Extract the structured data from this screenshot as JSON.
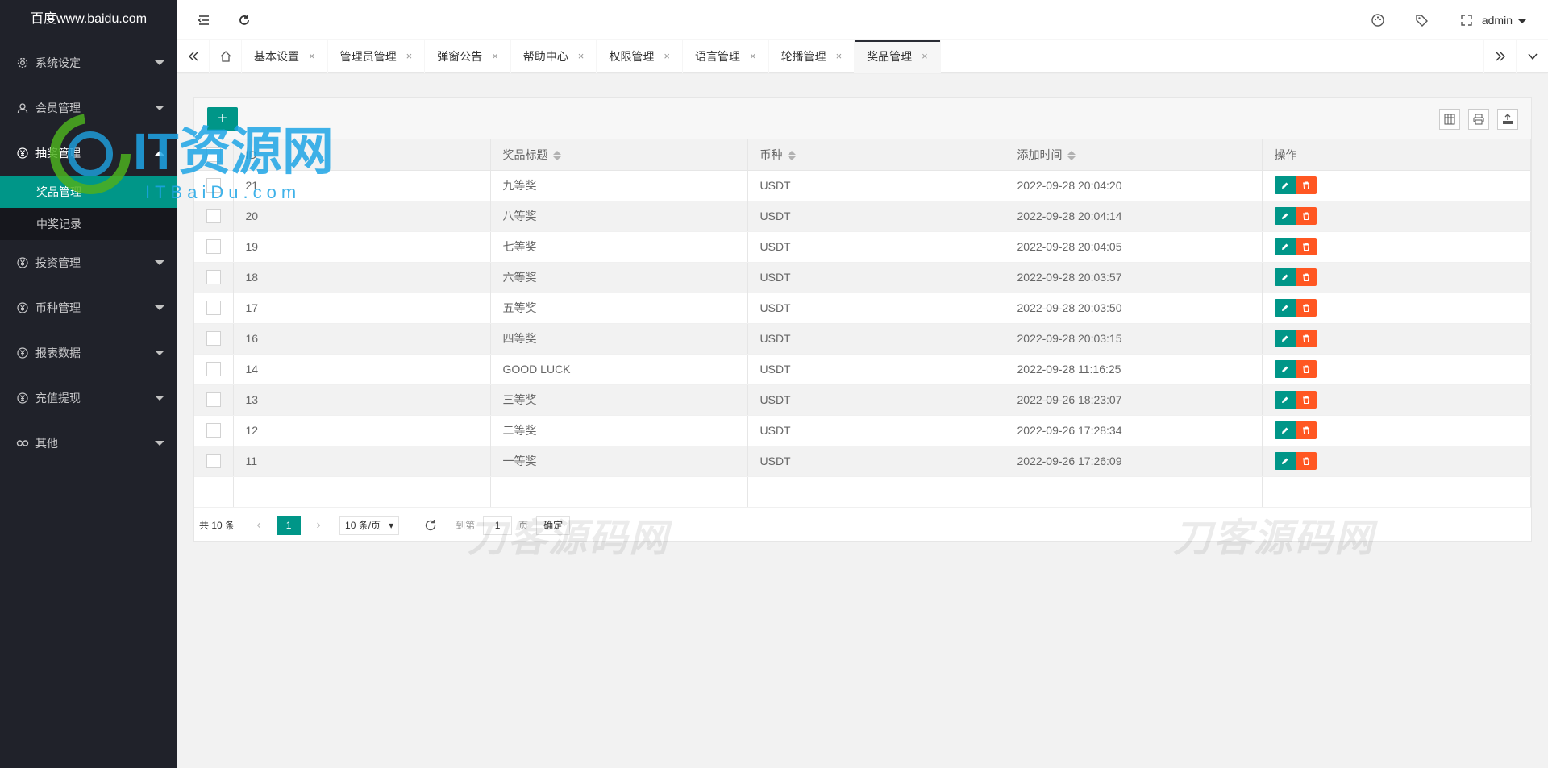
{
  "app": {
    "logo_text": "百度www.baidu.com"
  },
  "sidebar": {
    "items": [
      {
        "label": "系统设定",
        "icon": "gear-icon"
      },
      {
        "label": "会员管理",
        "icon": "user-icon"
      },
      {
        "label": "抽奖管理",
        "icon": "yen-icon",
        "open": true,
        "children": [
          {
            "label": "奖品管理",
            "active": true
          },
          {
            "label": "中奖记录"
          }
        ]
      },
      {
        "label": "投资管理",
        "icon": "yen-icon"
      },
      {
        "label": "币种管理",
        "icon": "yen-icon"
      },
      {
        "label": "报表数据",
        "icon": "yen-icon"
      },
      {
        "label": "充值提现",
        "icon": "yen-icon"
      },
      {
        "label": "其他",
        "icon": "link-icon"
      }
    ]
  },
  "header": {
    "user": "admin"
  },
  "tabs": [
    {
      "label": "基本设置"
    },
    {
      "label": "管理员管理"
    },
    {
      "label": "弹窗公告"
    },
    {
      "label": "帮助中心"
    },
    {
      "label": "权限管理"
    },
    {
      "label": "语言管理"
    },
    {
      "label": "轮播管理"
    },
    {
      "label": "奖品管理",
      "active": true
    }
  ],
  "tab_close_glyph": "×",
  "toolbar": {
    "add_label": "+"
  },
  "table": {
    "headers": {
      "id": "ID",
      "title": "奖品标题",
      "currency": "币种",
      "time": "添加时间",
      "ops": "操作"
    },
    "rows": [
      {
        "id": "21",
        "title": "九等奖",
        "currency": "USDT",
        "time": "2022-09-28 20:04:20"
      },
      {
        "id": "20",
        "title": "八等奖",
        "currency": "USDT",
        "time": "2022-09-28 20:04:14"
      },
      {
        "id": "19",
        "title": "七等奖",
        "currency": "USDT",
        "time": "2022-09-28 20:04:05"
      },
      {
        "id": "18",
        "title": "六等奖",
        "currency": "USDT",
        "time": "2022-09-28 20:03:57"
      },
      {
        "id": "17",
        "title": "五等奖",
        "currency": "USDT",
        "time": "2022-09-28 20:03:50"
      },
      {
        "id": "16",
        "title": "四等奖",
        "currency": "USDT",
        "time": "2022-09-28 20:03:15"
      },
      {
        "id": "14",
        "title": "GOOD LUCK",
        "currency": "USDT",
        "time": "2022-09-28 11:16:25"
      },
      {
        "id": "13",
        "title": "三等奖",
        "currency": "USDT",
        "time": "2022-09-26 18:23:07"
      },
      {
        "id": "12",
        "title": "二等奖",
        "currency": "USDT",
        "time": "2022-09-26 17:28:34"
      },
      {
        "id": "11",
        "title": "一等奖",
        "currency": "USDT",
        "time": "2022-09-26 17:26:09"
      }
    ]
  },
  "pager": {
    "count": "共 10 条",
    "current": "1",
    "per_page": "10 条/页",
    "goto_label": "到第",
    "goto_value": "1",
    "page_label": "页",
    "confirm": "确定"
  },
  "watermarks": {
    "logo_text": "IT资源网",
    "logo_sub": "ITBaiDu.com",
    "text": "刀客源码网"
  },
  "colors": {
    "accent": "#009688",
    "danger": "#ff5722",
    "sidebar_bg": "#20222a"
  }
}
